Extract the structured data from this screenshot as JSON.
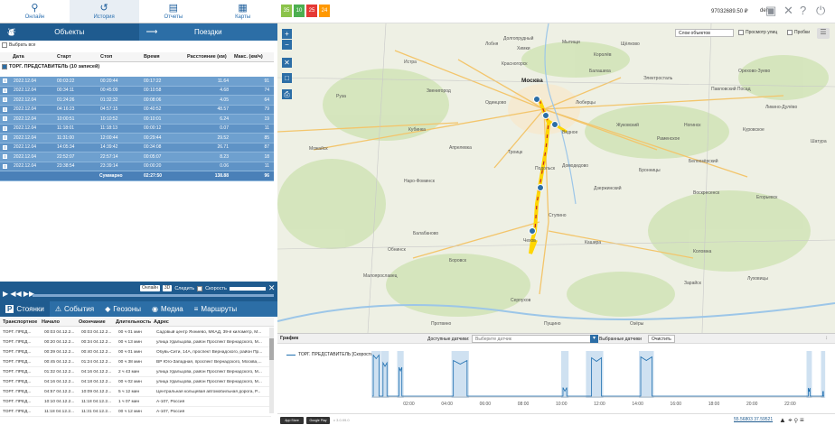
{
  "nav": [
    {
      "label": "Онлайн",
      "icon": "pin-icon"
    },
    {
      "label": "История",
      "icon": "history-icon"
    },
    {
      "label": "Отчеты",
      "icon": "reports-icon"
    },
    {
      "label": "Карты",
      "icon": "maps-icon"
    }
  ],
  "badges": [
    {
      "label": "35",
      "color": "#8bc34a"
    },
    {
      "label": "10",
      "color": "#4caf50"
    },
    {
      "label": "25",
      "color": "#e53935"
    },
    {
      "label": "24",
      "color": "#ff9800"
    }
  ],
  "balance": "97032689.50 ₽",
  "user": "demo",
  "left_tabs": {
    "objects": "Объекты",
    "trips": "Поездки"
  },
  "select_all": "Выбрать все",
  "table": {
    "headers": [
      "Дата",
      "Старт",
      "Стоп",
      "Время",
      "Расстояние (км)",
      "Макс. (км/ч)"
    ],
    "group": "ТОРГ. ПРЕДСТАВИТЕЛЬ (10 записей)",
    "rows": [
      [
        "2022.12.04",
        "00:03:22",
        "00:20:44",
        "00:17:22",
        "11.64",
        "91"
      ],
      [
        "2022.12.04",
        "00:34:11",
        "00:45:09",
        "00:10:58",
        "4.68",
        "74"
      ],
      [
        "2022.12.04",
        "01:24:26",
        "01:32:32",
        "00:08:06",
        "4.05",
        "64"
      ],
      [
        "2022.12.04",
        "04:16:23",
        "04:57:15",
        "00:40:52",
        "48.57",
        "79"
      ],
      [
        "2022.12.04",
        "10:00:51",
        "10:10:52",
        "00:10:01",
        "6.24",
        "19"
      ],
      [
        "2022.12.04",
        "11:18:01",
        "11:18:13",
        "00:00:12",
        "0.07",
        "11"
      ],
      [
        "2022.12.04",
        "11:31:00",
        "12:00:44",
        "00:29:44",
        "29.52",
        "85"
      ],
      [
        "2022.12.04",
        "14:05:34",
        "14:39:42",
        "00:34:08",
        "26.71",
        "87"
      ],
      [
        "2022.12.04",
        "22:52:07",
        "22:57:14",
        "00:05:07",
        "8.23",
        "18"
      ],
      [
        "2022.12.04",
        "23:38:54",
        "23:39:14",
        "00:00:20",
        "0.06",
        "11"
      ]
    ],
    "total": {
      "label": "Суммарно",
      "time": "02:27:50",
      "distance": "138.88",
      "max": "96"
    }
  },
  "player": {
    "online": "Онлайн",
    "threed": "3D",
    "follow": "Следить",
    "speed": "Скорость"
  },
  "bottom_tabs": [
    "Стоянки",
    "События",
    "Геозоны",
    "Медиа",
    "Маршруты"
  ],
  "stops": {
    "headers": [
      "Транспортное",
      "Начало",
      "Окончание",
      "Длительность",
      "Адрес"
    ],
    "rows": [
      [
        "ТОРГ. ПРЕД...",
        "00:03 04.12.2...",
        "00:03 04.12.2...",
        "00 ч 01 мин",
        "Садовый центр Яхниево, МКАД, 39-й километр, М..."
      ],
      [
        "ТОРГ. ПРЕД...",
        "00:20 04.12.2...",
        "00:34 04.12.2...",
        "00 ч 13 мин",
        "улица Удальцова, район Проспект Вернадского, М..."
      ],
      [
        "ТОРГ. ПРЕД...",
        "00:39 04.12.2...",
        "00:40 04.12.2...",
        "00 ч 01 мин",
        "Обувь-Сити, 14А, проспект Вернадского, район Пр..."
      ],
      [
        "ТОРГ. ПРЕД...",
        "00:45 04.12.2...",
        "01:24 04.12.2...",
        "00 ч 38 мин",
        "ВР Юго-Западная, проспект Вернадского, Москва,..."
      ],
      [
        "ТОРГ. ПРЕД...",
        "01:32 04.12.2...",
        "04:16 04.12.2...",
        "2 ч 43 мин",
        "улица Удальцова, район Проспект Вернадского, М..."
      ],
      [
        "ТОРГ. ПРЕД...",
        "04:16 04.12.2...",
        "04:18 04.12.2...",
        "00 ч 02 мин",
        "улица Удальцова, район Проспект Вернадского, М..."
      ],
      [
        "ТОРГ. ПРЕД...",
        "04:57 04.12.2...",
        "10:09 04.12.2...",
        "5 ч 12 мин",
        "Центральная кольцевая автомобильная дорога, Р..."
      ],
      [
        "ТОРГ. ПРЕД...",
        "10:10 04.12.2...",
        "11:18 04.12.2...",
        "1 ч 07 мин",
        "А-107, Россия"
      ],
      [
        "ТОРГ. ПРЕД...",
        "11:18 04.12.2...",
        "11:31 04.12.2...",
        "00 ч 12 мин",
        "А-107, Россия"
      ]
    ]
  },
  "map": {
    "layers": "Слои объектов",
    "street_view": "Просмотр улиц",
    "traffic": "Пробки",
    "cities": [
      {
        "name": "Москва",
        "big": true
      },
      {
        "name": "Химки"
      },
      {
        "name": "Мытищи"
      },
      {
        "name": "Балашиха"
      },
      {
        "name": "Электросталь"
      },
      {
        "name": "Одинцово"
      },
      {
        "name": "Люберцы"
      },
      {
        "name": "Жуковский"
      },
      {
        "name": "Подольск"
      },
      {
        "name": "Домодедово"
      },
      {
        "name": "Чехов"
      },
      {
        "name": "Серпухов"
      },
      {
        "name": "Наро-Фоминск"
      },
      {
        "name": "Обнинск"
      },
      {
        "name": "Коломна"
      },
      {
        "name": "Звенигород"
      },
      {
        "name": "Красногорск"
      },
      {
        "name": "Раменское"
      },
      {
        "name": "Можайск"
      },
      {
        "name": "Воскресенск"
      },
      {
        "name": "Ступино"
      },
      {
        "name": "Кубинка"
      },
      {
        "name": "Видное"
      },
      {
        "name": "Троицк"
      },
      {
        "name": "Щёлково"
      },
      {
        "name": "Королёв"
      },
      {
        "name": "Ногинск"
      },
      {
        "name": "Орехово-Зуево"
      },
      {
        "name": "Павловский Посад"
      },
      {
        "name": "Куровское"
      },
      {
        "name": "Шатура"
      },
      {
        "name": "Егорьевск"
      },
      {
        "name": "Бронницы"
      },
      {
        "name": "Малоярославец"
      },
      {
        "name": "Протвино"
      },
      {
        "name": "Пущино"
      },
      {
        "name": "Озёры"
      },
      {
        "name": "Зарайск"
      },
      {
        "name": "Луховицы"
      },
      {
        "name": "Кашира"
      },
      {
        "name": "Руза"
      },
      {
        "name": "Истра"
      },
      {
        "name": "Апрелевка"
      },
      {
        "name": "Балабаново"
      },
      {
        "name": "Боровск"
      },
      {
        "name": "Белоозёрский"
      },
      {
        "name": "Дзержинский"
      },
      {
        "name": "Ликино-Дулёво"
      },
      {
        "name": "Лобня"
      },
      {
        "name": "Долгопрудный"
      }
    ]
  },
  "graph": {
    "title": "График",
    "sensors_label": "Доступные датчики:",
    "sensor_placeholder": "Выберите датчик",
    "selected_sensors": "Выбранные датчики",
    "clear": "Очистить",
    "legend": "ТОРГ. ПРЕДСТАВИТЕЛЬ [Скорость]",
    "ticks": [
      "02:00",
      "04:00",
      "06:00",
      "08:00",
      "10:00",
      "12:00",
      "14:00",
      "16:00",
      "18:00",
      "20:00",
      "22:00"
    ]
  },
  "status": {
    "coords": "55.56803 37.59521",
    "appstore": "App Store",
    "googleplay": "Google Play",
    "version": "v 3.0.99.0"
  }
}
